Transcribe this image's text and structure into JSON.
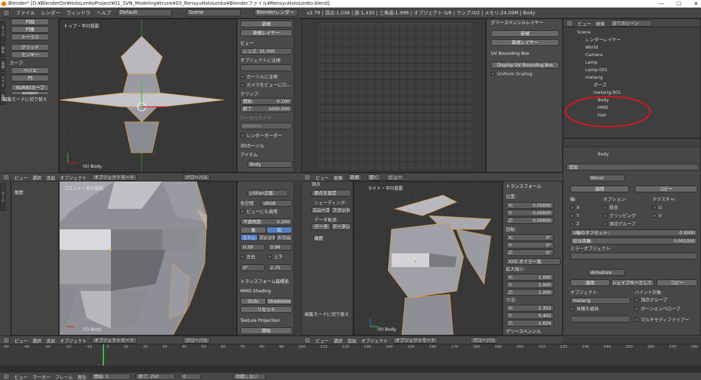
{
  "window": {
    "title": "Blender* [D:¥BlenderDir¥HoloLenKoProject¥01_SVN_Modeling¥trunk¥03_RensyuHoloLenko¥Blenderファイル¥RensyuHoloLenKo.blend]",
    "min": "—",
    "max": "☐",
    "close": "✕"
  },
  "menubar": {
    "items": [
      "ファイル",
      "レンダー",
      "ウィンドウ",
      "ヘルプ"
    ],
    "layout": "Default",
    "scene": "Scene",
    "engine": "Blenderレンダー",
    "stats": "v2.79 | 頂点:1,038 | 面:1,430 | 三角面:1,996 | オブジェクト:3/6 | ランプ:0/2 | メモリ:24.09M | Body"
  },
  "toolshelf": {
    "items": [
      "円柱",
      "円錐",
      "トーラス",
      "グリッド",
      "モンキー"
    ],
    "curve_label": "カーブ:",
    "curves": [
      "ベジエ",
      "円",
      "NURBSカーブ",
      "NURBS円"
    ],
    "toggle_edit": "編集モードに切り替え",
    "tabs": [
      "ツール",
      "作成",
      "関係",
      "アニメ",
      "物理",
      "グリースペンシル"
    ]
  },
  "vp_top": {
    "label": "トップ・平行投影",
    "obj": "(0) Body"
  },
  "vp_front": {
    "label": "フロント・平行投影",
    "obj": "(0) Body",
    "history": "履歴"
  },
  "vp_right": {
    "label": "ライト・平行投影",
    "obj": "(0) Body"
  },
  "npanel_top": {
    "new": "新規",
    "new_layer": "新規レイヤー",
    "view": "ビュー",
    "lens_label": "レンズ:",
    "lens": "35.000",
    "lock_label": "オブジェクトに注視:",
    "cursor_lock": "カーソルに注視",
    "camera_lock": "カメラをビューにロ...",
    "clip": "クリップ:",
    "clip_start_label": "開始:",
    "clip_start": "0.100",
    "clip_end_label": "終了:",
    "clip_end": "1000.000",
    "local_cam": "ローカルカメラ:",
    "camera": "Camera",
    "render_border": "レンダーボーダー",
    "cursor3d": "3Dカーソル",
    "item": "アイテム",
    "body": "Body"
  },
  "npanel_mid": {
    "l1": "頂点",
    "l2": "原点を設定",
    "shading": "シェーディング:",
    "smooth": "スムーズ",
    "flat": "フラット",
    "data_transfer": "データ転送:",
    "data": "データ",
    "data2": "データレ",
    "history": "履歴"
  },
  "img_panel": {
    "field": "J:Sitan正面..",
    "color_space_label": "色空間",
    "color_space": "sRGB",
    "view_apply": "ビューにも適用",
    "opacity_label": "不透明度:",
    "opacity": "0.200",
    "tab_a": "後",
    "tab_b": "前",
    "stretch": "ストレ",
    "fit": "フィット",
    "crop": "トリム",
    "v1": "0.59",
    "v2": "0.96",
    "flip_h": "左右",
    "flip_v": "上下",
    "rot": "0°",
    "scale": "2.75",
    "transform_orient": "トランスフォーム座標系",
    "mmd": "MMD Shading",
    "glsl": "GLSL",
    "shadeless": "Shadeless",
    "reset": "リセット",
    "texproj": "Texture Projection",
    "start": "開始"
  },
  "uv": {
    "grease": "グリースペンシルレイヤー",
    "new": "新規",
    "new_layer": "新規レイヤー",
    "bbox": "UV Bounding Box",
    "display_bbox": "Display UV Bounding Box",
    "uniform": "Uniform Scaling"
  },
  "transform": {
    "title": "トランスフォーム",
    "loc": "位置:",
    "x": "0.00000",
    "y": "0.00000",
    "z": "0.00000",
    "rot": "回転:",
    "rx": "0°",
    "ry": "0°",
    "rz": "0°",
    "mode": "XYZ オイラー角",
    "scale": "拡大縮小:",
    "sx": "1.000",
    "sy": "1.000",
    "sz": "1.000",
    "dims": "寸法:",
    "dx": "1.352",
    "dy": "0.402",
    "dz": "1.624",
    "grease": "グリースペンシル"
  },
  "outliner": {
    "menu": [
      "ビュー",
      "検索"
    ],
    "scenes": "全てのシーン",
    "items": [
      "Scene",
      "レンダーレイヤー",
      "World",
      "Camera",
      "Lamp",
      "Lamp.001",
      "metarig",
      "ポーズ",
      "metarig.001",
      "Body",
      "HMD",
      "Hair"
    ]
  },
  "props": {
    "obj": "Body",
    "add": "追加",
    "mirror": "Mirror",
    "apply": "適用",
    "copy": "コピー",
    "axis": "軸:",
    "options": "オプション:",
    "texture": "テクスチャ:",
    "x": "X",
    "y": "Y",
    "z": "Z",
    "merge": "結合",
    "clipping": "クリッピング",
    "vgroup": "頂点グループ",
    "u": "U",
    "v": "V",
    "uoffset_label": "U軸のオフセット:",
    "uoffset": "0.0000",
    "merge_dist_label": "結合距離:",
    "merge_dist": "0.001000",
    "mirror_obj": "ミラーオブジェクト:",
    "armature": "Armature",
    "shapekey": "シェイプキーとして...",
    "bind_to": "バインド対象:",
    "obj_label": "オブジェクト:",
    "metarig": "metarig",
    "vgroups": "頂点グループ",
    "preserve": "体積を維持",
    "bone_env": "ボーンエンベロープ",
    "multi": "マルチモディファイアー"
  },
  "vp_header": {
    "view": "ビュー",
    "select": "選択",
    "add": "追加",
    "object": "オブジェクト",
    "mode": "オブジェクトモード",
    "global": "グローバル"
  },
  "img_header": {
    "view": "ビュー",
    "image": "画像",
    "new": "新規",
    "open": "開く",
    "view2": "ビュー"
  },
  "timeline": {
    "ticks": [
      "-50",
      "-40",
      "-30",
      "-20",
      "-10",
      "0",
      "10",
      "20",
      "30",
      "40",
      "50",
      "60",
      "70",
      "80",
      "90",
      "100",
      "110",
      "120",
      "130",
      "140",
      "150",
      "160",
      "170",
      "180",
      "190",
      "200",
      "210",
      "220",
      "230",
      "240",
      "250",
      "260",
      "270",
      "280"
    ],
    "menu": [
      "ビュー",
      "マーカー",
      "フレーム",
      "再生"
    ],
    "start_label": "開始:",
    "start": "1",
    "end_label": "終了:",
    "end": "250",
    "frame": "0",
    "sync": "同期しない"
  },
  "colors": {
    "accent": "#5680c2",
    "selection": "#e8a040",
    "annotation": "#e0141e"
  }
}
